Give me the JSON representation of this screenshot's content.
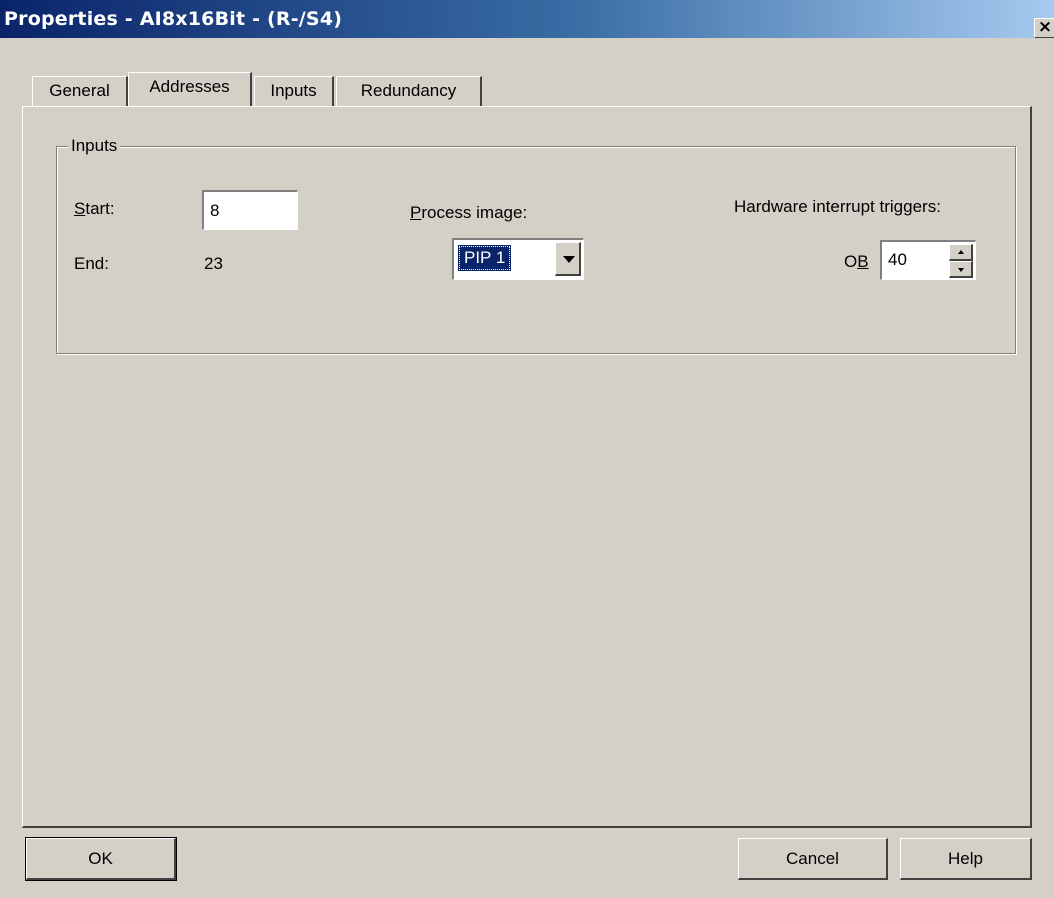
{
  "window": {
    "title": "Properties - AI8x16Bit - (R-/S4)",
    "close_glyph": "×"
  },
  "tabs": [
    {
      "label": "General",
      "active": false
    },
    {
      "label": "Addresses",
      "active": true
    },
    {
      "label": "Inputs",
      "active": false
    },
    {
      "label": "Redundancy",
      "active": false
    }
  ],
  "inputs_group": {
    "label": "Inputs",
    "start": {
      "label_accel": "S",
      "label_rest": "tart:",
      "value": "8"
    },
    "end": {
      "label": "End:",
      "value": "23"
    },
    "process_image": {
      "label_accel": "P",
      "label_rest": "rocess image:",
      "selected": "PIP 1"
    },
    "hw_interrupt": {
      "label": "Hardware interrupt triggers:",
      "ob_label_pre": "O",
      "ob_label_accel": "B",
      "ob_value": "40"
    }
  },
  "buttons": {
    "ok": "OK",
    "cancel": "Cancel",
    "help": "Help"
  },
  "colors": {
    "dialog_bg": "#d4d0c8",
    "title_start": "#0a246a",
    "title_end": "#a6caf0",
    "selection": "#0a246a"
  }
}
